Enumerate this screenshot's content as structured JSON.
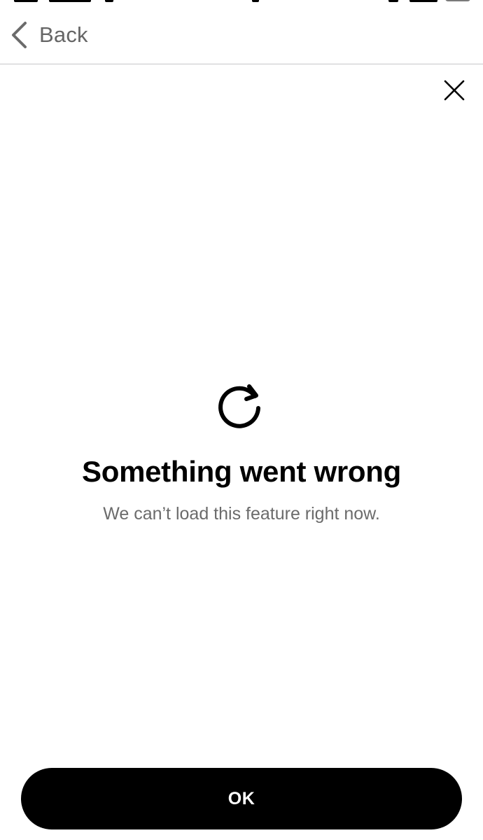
{
  "nav": {
    "back_label": "Back",
    "back_icon": "chevron-left-icon",
    "close_icon": "close-icon"
  },
  "error": {
    "icon": "refresh-icon",
    "title": "Something went wrong",
    "message": "We can’t load this feature right now."
  },
  "actions": {
    "ok_label": "OK"
  },
  "colors": {
    "background": "#ffffff",
    "title": "#000000",
    "message": "#6b6b6b",
    "nav_text": "#666666",
    "divider": "#c6c6c8",
    "button_bg": "#000000",
    "button_text": "#ffffff"
  }
}
